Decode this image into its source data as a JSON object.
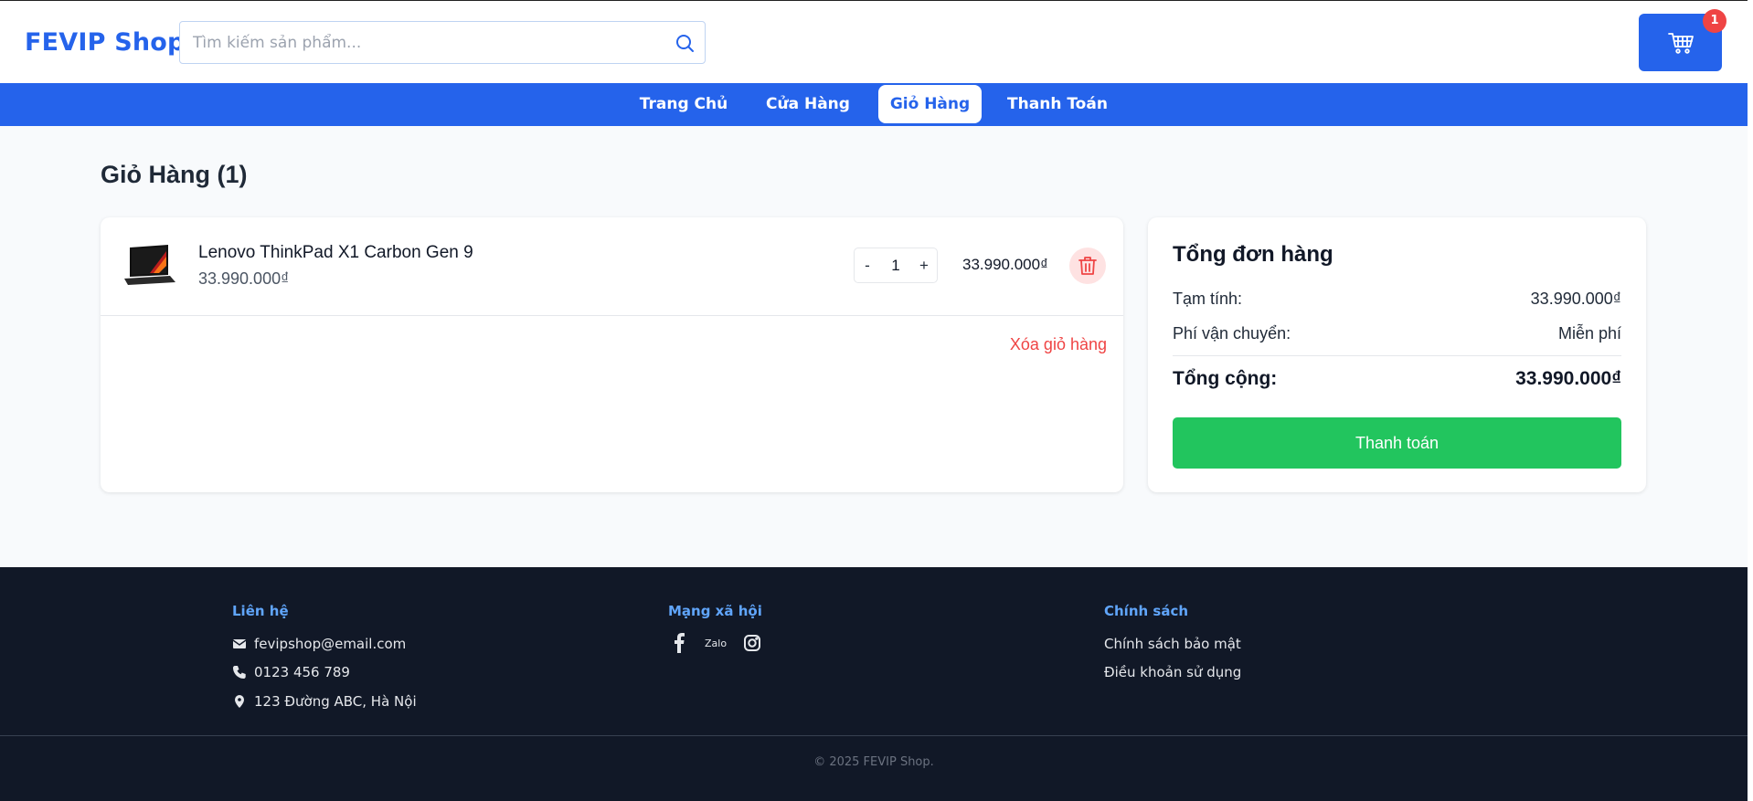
{
  "header": {
    "brand": "FEVIP Shop",
    "search_placeholder": "Tìm kiếm sản phẩm...",
    "cart_count": "1"
  },
  "nav": {
    "tabs": [
      {
        "label": "Trang Chủ"
      },
      {
        "label": "Cửa Hàng"
      },
      {
        "label": "Giỏ Hàng",
        "active": true
      },
      {
        "label": "Thanh Toán"
      }
    ]
  },
  "cart": {
    "title": "Giỏ Hàng (1)",
    "items": [
      {
        "name": "Lenovo ThinkPad X1 Carbon Gen 9",
        "unit_price": "33.990.000₫",
        "quantity": "1",
        "line_total": "33.990.000₫",
        "minus": "-",
        "plus": "+"
      }
    ],
    "clear_label": "Xóa giỏ hàng"
  },
  "summary": {
    "title": "Tổng đơn hàng",
    "subtotal_label": "Tạm tính:",
    "subtotal_value": "33.990.000₫",
    "shipping_label": "Phí vận chuyển:",
    "shipping_value": "Miễn phí",
    "total_label": "Tổng cộng:",
    "total_value": "33.990.000₫",
    "checkout_label": "Thanh toán"
  },
  "footer": {
    "contact": {
      "heading": "Liên hệ",
      "email": "fevipshop@email.com",
      "phone": "0123 456 789",
      "address": "123 Đường ABC, Hà Nội"
    },
    "social": {
      "heading": "Mạng xã hội",
      "zalo": "Zalo"
    },
    "policy": {
      "heading": "Chính sách",
      "privacy": "Chính sách bảo mật",
      "terms": "Điều khoản sử dụng"
    },
    "copyright": "© 2025 FEVIP Shop."
  },
  "colors": {
    "primary": "#2563eb",
    "success": "#22c55e",
    "danger": "#ef4444",
    "footer_bg": "#111827"
  }
}
